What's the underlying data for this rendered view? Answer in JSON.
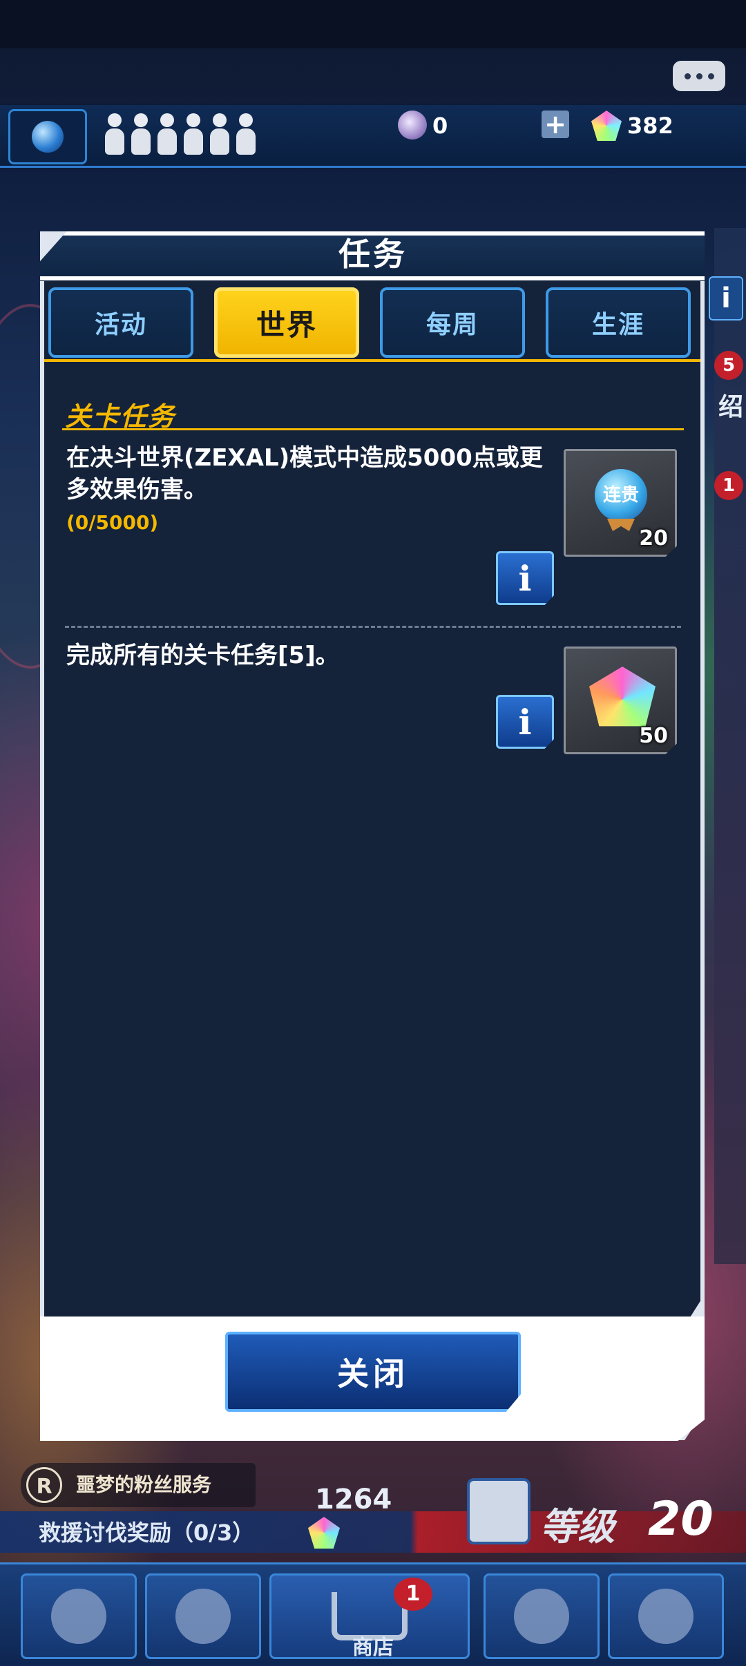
{
  "header": {
    "orb_count": "0",
    "gem_count": "382",
    "plus_label": "+"
  },
  "side": {
    "info_label": "i",
    "badge_top": "5",
    "side_text": "绍",
    "badge_bottom": "1"
  },
  "dialog": {
    "title": "任务",
    "tabs": [
      {
        "label": "活动",
        "active": false
      },
      {
        "label": "世界",
        "active": true
      },
      {
        "label": "每周",
        "active": false
      },
      {
        "label": "生涯",
        "active": false
      }
    ],
    "section_title": "关卡任务",
    "missions": [
      {
        "text": "在决斗世界(ZEXAL)模式中造成5000点或更多效果伤害。",
        "progress": "(0/5000)",
        "reward_icon": "ticket-icon",
        "reward_icon_text": "连贵",
        "reward_count": "20",
        "info_label": "i"
      },
      {
        "text": "完成所有的关卡任务[5]。",
        "progress": "",
        "reward_icon": "gem-icon",
        "reward_icon_text": "",
        "reward_count": "50",
        "info_label": "i"
      }
    ],
    "close_label": "关闭"
  },
  "hud": {
    "promo_text": "噩梦的粉丝服务",
    "promo_logo": "R",
    "rescue_text": "救援讨伐奖励（0/3）",
    "score": "1264",
    "level_label": "等级",
    "level_value": "20"
  },
  "nav": {
    "shop_label": "商店",
    "shop_badge": "1"
  }
}
